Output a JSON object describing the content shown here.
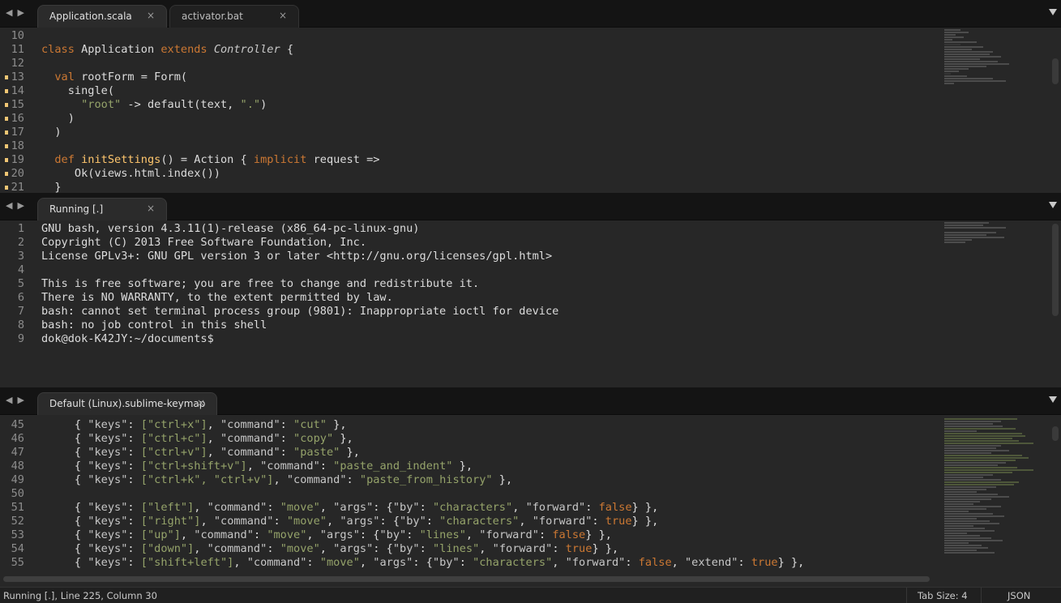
{
  "panes": [
    {
      "tabs": [
        {
          "label": "Application.scala",
          "active": true
        },
        {
          "label": "activator.bat",
          "active": false
        }
      ]
    },
    {
      "tabs": [
        {
          "label": "Running [.]",
          "active": true
        }
      ]
    },
    {
      "tabs": [
        {
          "label": "Default (Linux).sublime-keymap",
          "active": true
        }
      ]
    }
  ],
  "icons": {
    "nav_left": "◀",
    "nav_right": "▶",
    "close": "×"
  },
  "editor1": {
    "lines": [
      {
        "num": "10",
        "mod": false
      },
      {
        "num": "11",
        "mod": false
      },
      {
        "num": "12",
        "mod": false
      },
      {
        "num": "13",
        "mod": true
      },
      {
        "num": "14",
        "mod": true
      },
      {
        "num": "15",
        "mod": true
      },
      {
        "num": "16",
        "mod": true
      },
      {
        "num": "17",
        "mod": true
      },
      {
        "num": "18",
        "mod": true
      },
      {
        "num": "19",
        "mod": true
      },
      {
        "num": "20",
        "mod": true
      },
      {
        "num": "21",
        "mod": true
      }
    ],
    "tokens": {
      "class": "class",
      "application": " Application ",
      "extends": "extends",
      "controller": "Controller",
      "brace_open": " {",
      "val": "val",
      "rootform": " rootForm = Form(",
      "single": "single(",
      "root_str": "\"root\"",
      "arrow": " -> default(text, ",
      "dot_str": "\".\"",
      "close_paren": ")",
      "def": "def",
      "initsettings": "initSettings",
      "action": "() = Action { ",
      "implicit": "implicit",
      "request": " request =>",
      "ok": "Ok(views.html.index())",
      "brace_close": "}"
    }
  },
  "terminal": {
    "lines": [
      {
        "num": "1",
        "text": "GNU bash, version 4.3.11(1)-release (x86_64-pc-linux-gnu)"
      },
      {
        "num": "2",
        "text": "Copyright (C) 2013 Free Software Foundation, Inc."
      },
      {
        "num": "3",
        "text": "License GPLv3+: GNU GPL version 3 or later <http://gnu.org/licenses/gpl.html>"
      },
      {
        "num": "4",
        "text": ""
      },
      {
        "num": "5",
        "text": "This is free software; you are free to change and redistribute it."
      },
      {
        "num": "6",
        "text": "There is NO WARRANTY, to the extent permitted by law."
      },
      {
        "num": "7",
        "text": "bash: cannot set terminal process group (9801): Inappropriate ioctl for device"
      },
      {
        "num": "8",
        "text": "bash: no job control in this shell"
      },
      {
        "num": "9",
        "text": "dok@dok-K42JY:~/documents$"
      }
    ]
  },
  "keymap": {
    "lines": [
      {
        "num": "45",
        "keys": "[\"ctrl+x\"]",
        "command": "\"cut\"",
        "args": null
      },
      {
        "num": "46",
        "keys": "[\"ctrl+c\"]",
        "command": "\"copy\"",
        "args": null
      },
      {
        "num": "47",
        "keys": "[\"ctrl+v\"]",
        "command": "\"paste\"",
        "args": null
      },
      {
        "num": "48",
        "keys": "[\"ctrl+shift+v\"]",
        "command": "\"paste_and_indent\"",
        "args": null
      },
      {
        "num": "49",
        "keys": "[\"ctrl+k\", \"ctrl+v\"]",
        "command": "\"paste_from_history\"",
        "args": null
      },
      {
        "num": "50",
        "keys": null,
        "command": null,
        "args": null
      },
      {
        "num": "51",
        "keys": "[\"left\"]",
        "command": "\"move\"",
        "args": {
          "by": "\"characters\"",
          "forward": "false"
        }
      },
      {
        "num": "52",
        "keys": "[\"right\"]",
        "command": "\"move\"",
        "args": {
          "by": "\"characters\"",
          "forward": "true"
        }
      },
      {
        "num": "53",
        "keys": "[\"up\"]",
        "command": "\"move\"",
        "args": {
          "by": "\"lines\"",
          "forward": "false"
        }
      },
      {
        "num": "54",
        "keys": "[\"down\"]",
        "command": "\"move\"",
        "args": {
          "by": "\"lines\"",
          "forward": "true"
        }
      },
      {
        "num": "55",
        "keys": "[\"shift+left\"]",
        "command": "\"move\"",
        "args": {
          "by": "\"characters\"",
          "forward": "false",
          "extend": "true"
        }
      }
    ],
    "labels": {
      "keys": "\"keys\"",
      "command": "\"command\"",
      "args": "\"args\"",
      "by": "\"by\"",
      "forward": "\"forward\"",
      "extend": "\"extend\""
    }
  },
  "status": {
    "position": "Running [.], Line 225, Column 30",
    "tab_size": "Tab Size: 4",
    "syntax": "JSON"
  },
  "colors": {
    "keyword": "#cc7833",
    "string": "#95a36a",
    "function": "#ffc66d",
    "modified_marker": "#f0c674"
  }
}
